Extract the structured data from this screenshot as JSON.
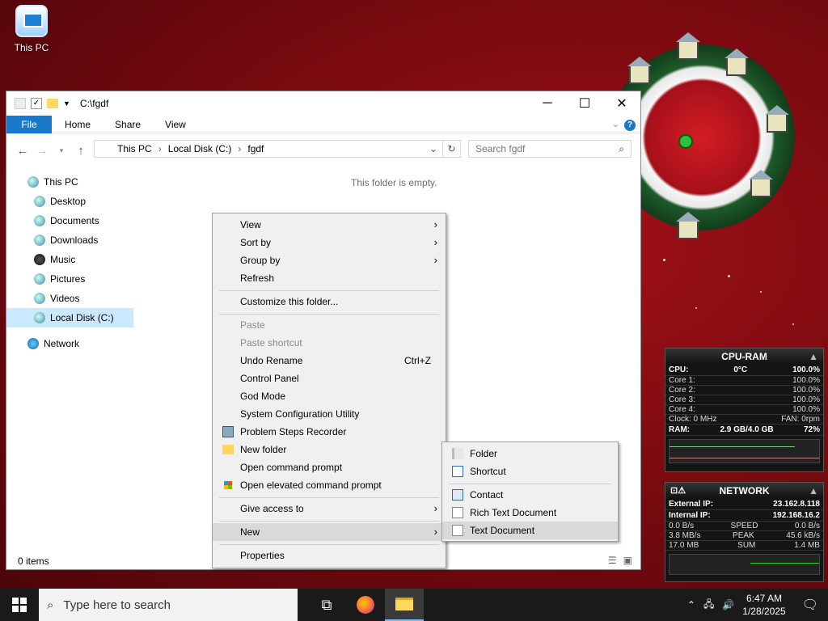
{
  "desktop": {
    "icons": [
      {
        "label": "This PC",
        "icon": "this-pc-icon"
      }
    ]
  },
  "explorer": {
    "title": "C:\\fgdf",
    "ribbon": {
      "file": "File",
      "tabs": [
        "Home",
        "Share",
        "View"
      ]
    },
    "address": {
      "parts": [
        "This PC",
        "Local Disk (C:)",
        "fgdf"
      ]
    },
    "search_placeholder": "Search fgdf",
    "nav": [
      {
        "label": "This PC",
        "icon": "this-pc-icon"
      },
      {
        "label": "Desktop",
        "icon": "desktop-icon"
      },
      {
        "label": "Documents",
        "icon": "documents-icon"
      },
      {
        "label": "Downloads",
        "icon": "downloads-icon"
      },
      {
        "label": "Music",
        "icon": "music-icon"
      },
      {
        "label": "Pictures",
        "icon": "pictures-icon"
      },
      {
        "label": "Videos",
        "icon": "videos-icon"
      },
      {
        "label": "Local Disk (C:)",
        "icon": "drive-icon"
      },
      {
        "label": "Network",
        "icon": "network-icon"
      }
    ],
    "empty_text": "This folder is empty.",
    "status": "0 items"
  },
  "context_menu": {
    "items": {
      "view": "View",
      "sort_by": "Sort by",
      "group_by": "Group by",
      "refresh": "Refresh",
      "customize": "Customize this folder...",
      "paste": "Paste",
      "paste_shortcut": "Paste shortcut",
      "undo_rename": "Undo Rename",
      "undo_shortcut": "Ctrl+Z",
      "control_panel": "Control Panel",
      "god_mode": "God Mode",
      "msconfig": "System Configuration Utility",
      "psr": "Problem Steps Recorder",
      "new_folder": "New folder",
      "open_cmd": "Open command prompt",
      "open_cmd_elev": "Open elevated command prompt",
      "give_access": "Give access to",
      "new": "New",
      "properties": "Properties"
    }
  },
  "new_submenu": {
    "items": {
      "folder": "Folder",
      "shortcut": "Shortcut",
      "contact": "Contact",
      "rtf": "Rich Text Document",
      "txt": "Text Document"
    }
  },
  "cpu_gadget": {
    "title": "CPU-RAM",
    "cpu_label": "CPU:",
    "cpu_temp": "0°C",
    "cpu_pct": "100.0%",
    "cores": [
      {
        "label": "Core 1:",
        "value": "100.0%"
      },
      {
        "label": "Core 2:",
        "value": "100.0%"
      },
      {
        "label": "Core 3:",
        "value": "100.0%"
      },
      {
        "label": "Core 4:",
        "value": "100.0%"
      }
    ],
    "clock": "Clock: 0 MHz",
    "fan": "FAN: 0rpm",
    "ram_label": "RAM:",
    "ram_used": "2.9 GB/4.0 GB",
    "ram_pct": "72%"
  },
  "net_gadget": {
    "title": "NETWORK",
    "external_label": "External IP:",
    "external_ip": "23.162.8.118",
    "internal_label": "Internal IP:",
    "internal_ip": "192.168.16.2",
    "rows": [
      {
        "left": "0.0 B/s",
        "mid": "SPEED",
        "right": "0.0 B/s"
      },
      {
        "left": "3.8 MB/s",
        "mid": "PEAK",
        "right": "45.6 kB/s"
      },
      {
        "left": "17.0 MB",
        "mid": "SUM",
        "right": "1.4 MB"
      }
    ]
  },
  "taskbar": {
    "search_placeholder": "Type here to search",
    "time": "6:47 AM",
    "date": "1/28/2025"
  },
  "colors": {
    "accent": "#1979ca",
    "selection": "#cce8ff",
    "taskbar": "#1a1a1a"
  }
}
